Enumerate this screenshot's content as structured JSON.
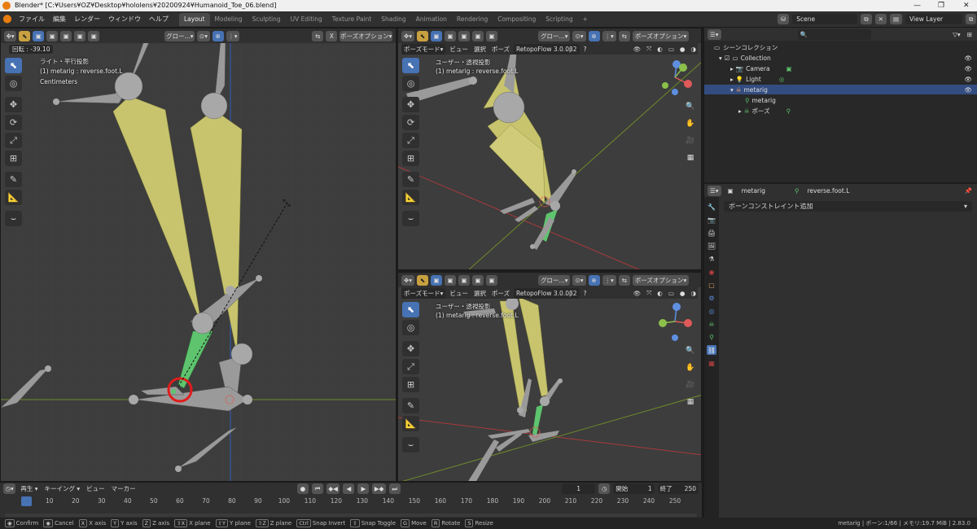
{
  "window": {
    "title": "Blender* [C:¥Users¥OZ¥Desktop¥hololens¥20200924¥Humanoid_Toe_06.blend]"
  },
  "topbar": {
    "menus": [
      "ファイル",
      "編集",
      "レンダー",
      "ウィンドウ",
      "ヘルプ"
    ],
    "workspaces": [
      "Layout",
      "Modeling",
      "Sculpting",
      "UV Editing",
      "Texture Paint",
      "Shading",
      "Animation",
      "Rendering",
      "Compositing",
      "Scripting"
    ],
    "active_workspace": "Layout",
    "add_tab": "+",
    "scene_label": "Scene",
    "view_layer_label": "View Layer"
  },
  "viewport_left": {
    "orientation_dropdown": "グロー...",
    "x_toggle": "X",
    "pose_options": "ポーズオプション",
    "rotation_readout": "回転 : -39.10",
    "view_name": "ライト・平行投影",
    "selection_info": "(1) metarig : reverse.foot.L",
    "units": "Centimeters"
  },
  "viewport_top_right": {
    "mode_dropdown": "ポーズモード",
    "menu_view": "ビュー",
    "menu_select": "選択",
    "menu_pose": "ポーズ",
    "addon_label": "RetopoFlow 3.0.0β2",
    "orientation_dropdown": "グロー...",
    "pose_options": "ポーズオプション",
    "view_name": "ユーザー・透視投影",
    "selection_info": "(1) metarig : reverse.foot.L"
  },
  "viewport_bottom_right": {
    "mode_dropdown": "ポーズモード",
    "menu_view": "ビュー",
    "menu_select": "選択",
    "menu_pose": "ポーズ",
    "addon_label": "RetopoFlow 3.0.0β2",
    "orientation_dropdown": "グロー...",
    "pose_options": "ポーズオプション",
    "view_name": "ユーザー・透視投影",
    "selection_info": "(1) metarig : reverse.foot.L"
  },
  "outliner": {
    "root": "シーンコレクション",
    "items": [
      {
        "label": "Collection"
      },
      {
        "label": "Camera"
      },
      {
        "label": "Light"
      },
      {
        "label": "metarig"
      },
      {
        "label": "metarig"
      },
      {
        "label": "ポーズ"
      }
    ]
  },
  "properties": {
    "object_name": "metarig",
    "bone_name": "reverse.foot.L",
    "add_constraint_dropdown": "ボーンコンストレイント追加"
  },
  "timeline": {
    "menus": [
      "再生",
      "キーイング",
      "ビュー",
      "マーカー"
    ],
    "current_frame": "1",
    "start_label": "開始",
    "start_value": "1",
    "end_label": "終了",
    "end_value": "250",
    "ticks": [
      "1",
      "10",
      "20",
      "30",
      "40",
      "50",
      "60",
      "70",
      "80",
      "90",
      "100",
      "110",
      "120",
      "130",
      "140",
      "150",
      "160",
      "170",
      "180",
      "190",
      "200",
      "210",
      "220",
      "230",
      "240",
      "250"
    ]
  },
  "statusbar": {
    "items": [
      {
        "key": "",
        "label": "Confirm"
      },
      {
        "key": "",
        "label": "Cancel"
      },
      {
        "key": "X",
        "label": "X axis"
      },
      {
        "key": "Y",
        "label": "Y axis"
      },
      {
        "key": "Z",
        "label": "Z axis"
      },
      {
        "key": "⇧X",
        "label": "X plane"
      },
      {
        "key": "⇧Y",
        "label": "Y plane"
      },
      {
        "key": "⇧Z",
        "label": "Z plane"
      },
      {
        "key": "Ctrl",
        "label": "Snap Invert"
      },
      {
        "key": "⇧",
        "label": "Snap Toggle"
      },
      {
        "key": "G",
        "label": "Move"
      },
      {
        "key": "R",
        "label": "Rotate"
      },
      {
        "key": "S",
        "label": "Resize"
      }
    ],
    "right_info": "metarig | ボーン:1/66 | メモリ:19.7 MiB | 2.83.0"
  },
  "colors": {
    "accent_blue": "#4772b3",
    "bone_yellow": "#c8c46e",
    "bone_gray": "#9a9a9a",
    "bone_green": "#5ec46e",
    "highlight_red": "#e11c1c",
    "x_axis": "#a83a3a",
    "y_axis": "#6e8a2a",
    "z_axis": "#2f5fb8"
  }
}
